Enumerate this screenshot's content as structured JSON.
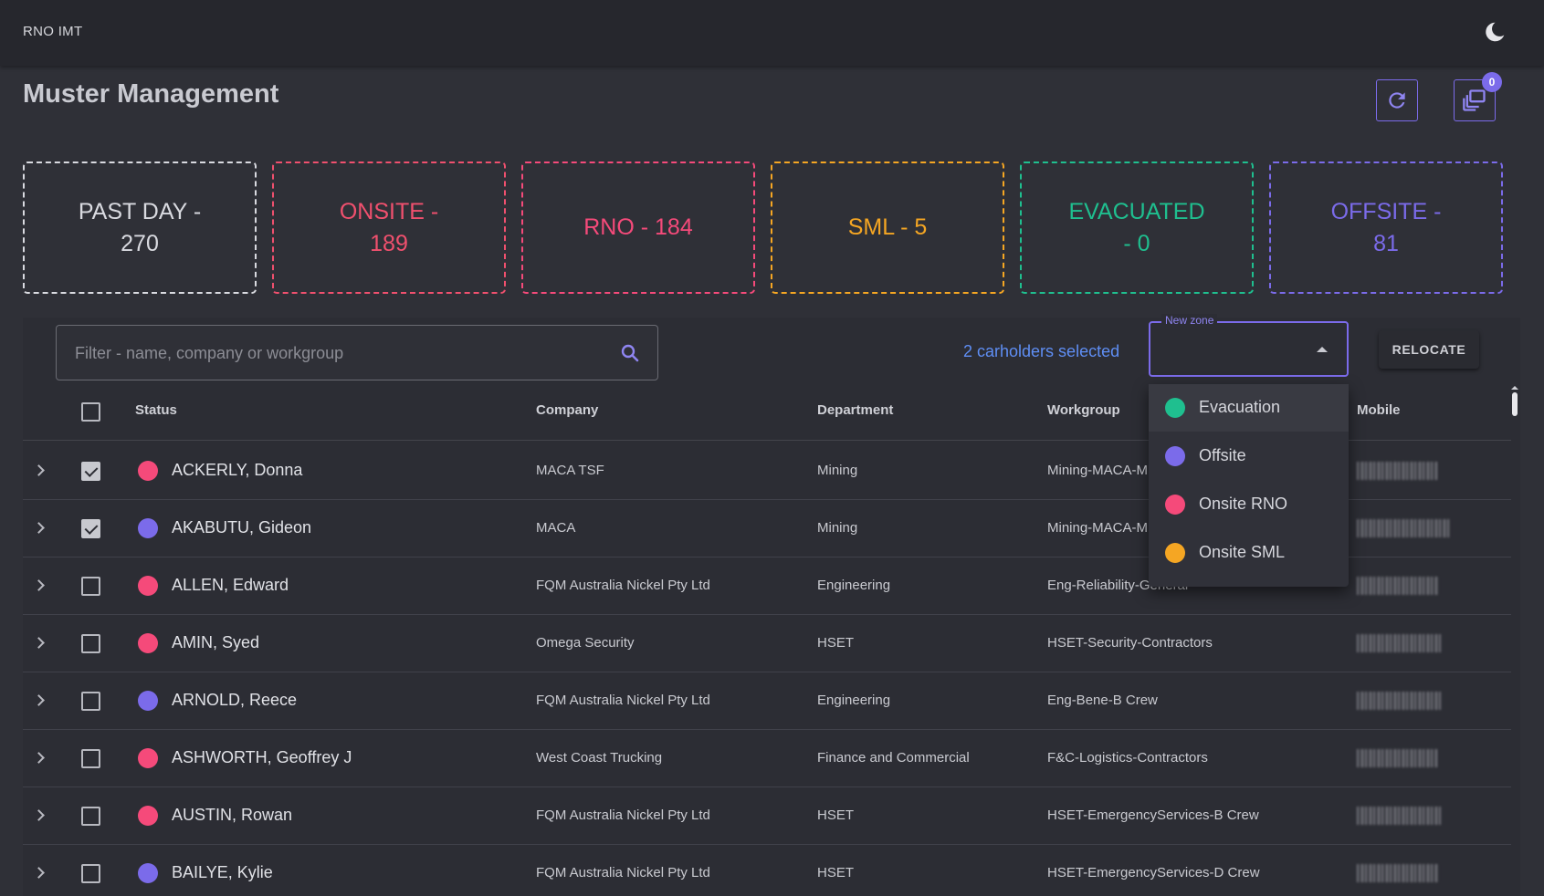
{
  "app": {
    "brand": "RNO IMT",
    "theme_icon": "moon-icon"
  },
  "page": {
    "title": "Muster Management",
    "refresh_icon": "refresh-icon",
    "queue_icon": "stacked-windows-icon",
    "queue_badge": "0"
  },
  "stats": [
    {
      "label": "PAST DAY - 270",
      "color": "#d9dae0",
      "border": "#d9dae0"
    },
    {
      "label": "ONSITE - 189",
      "color": "#f0506e",
      "border": "#f0506e"
    },
    {
      "label": "RNO - 184",
      "color": "#f54a7a",
      "border": "#f54a7a"
    },
    {
      "label": "SML - 5",
      "color": "#f5a623",
      "border": "#f5a623"
    },
    {
      "label": "EVACUATED - 0",
      "color": "#1fbf8f",
      "border": "#1fbf8f"
    },
    {
      "label": "OFFSITE - 81",
      "color": "#7b6bea",
      "border": "#7b6bea"
    }
  ],
  "toolbar": {
    "search_placeholder": "Filter - name, company or workgroup",
    "selected_text": "2 carholders selected",
    "zone_label": "New zone",
    "relocate_label": "RELOCATE"
  },
  "table": {
    "headers": {
      "status": "Status",
      "company": "Company",
      "department": "Department",
      "workgroup": "Workgroup",
      "mobile": "Mobile"
    },
    "rows": [
      {
        "name": "ACKERLY, Donna",
        "company": "MACA TSF",
        "department": "Mining",
        "workgroup": "Mining-MACA-M",
        "status_color": "#f54a7a",
        "checked": true
      },
      {
        "name": "AKABUTU, Gideon",
        "company": "MACA",
        "department": "Mining",
        "workgroup": "Mining-MACA-M",
        "status_color": "#7b6bea",
        "checked": true
      },
      {
        "name": "ALLEN, Edward",
        "company": "FQM Australia Nickel Pty Ltd",
        "department": "Engineering",
        "workgroup": "Eng-Reliability-General",
        "status_color": "#f54a7a",
        "checked": false
      },
      {
        "name": "AMIN, Syed",
        "company": "Omega Security",
        "department": "HSET",
        "workgroup": "HSET-Security-Contractors",
        "status_color": "#f54a7a",
        "checked": false
      },
      {
        "name": "ARNOLD, Reece",
        "company": "FQM Australia Nickel Pty Ltd",
        "department": "Engineering",
        "workgroup": "Eng-Bene-B Crew",
        "status_color": "#7b6bea",
        "checked": false
      },
      {
        "name": "ASHWORTH, Geoffrey J",
        "company": "West Coast Trucking",
        "department": "Finance and Commercial",
        "workgroup": "F&C-Logistics-Contractors",
        "status_color": "#f54a7a",
        "checked": false
      },
      {
        "name": "AUSTIN, Rowan",
        "company": "FQM Australia Nickel Pty Ltd",
        "department": "HSET",
        "workgroup": "HSET-EmergencyServices-B Crew",
        "status_color": "#f54a7a",
        "checked": false
      },
      {
        "name": "BAILYE, Kylie",
        "company": "FQM Australia Nickel Pty Ltd",
        "department": "HSET",
        "workgroup": "HSET-EmergencyServices-D Crew",
        "status_color": "#7b6bea",
        "checked": false
      }
    ]
  },
  "zone_options": [
    {
      "label": "Evacuation",
      "color": "#1fbf8f"
    },
    {
      "label": "Offsite",
      "color": "#7b6bea"
    },
    {
      "label": "Onsite RNO",
      "color": "#f54a7a"
    },
    {
      "label": "Onsite SML",
      "color": "#f5a623"
    }
  ]
}
